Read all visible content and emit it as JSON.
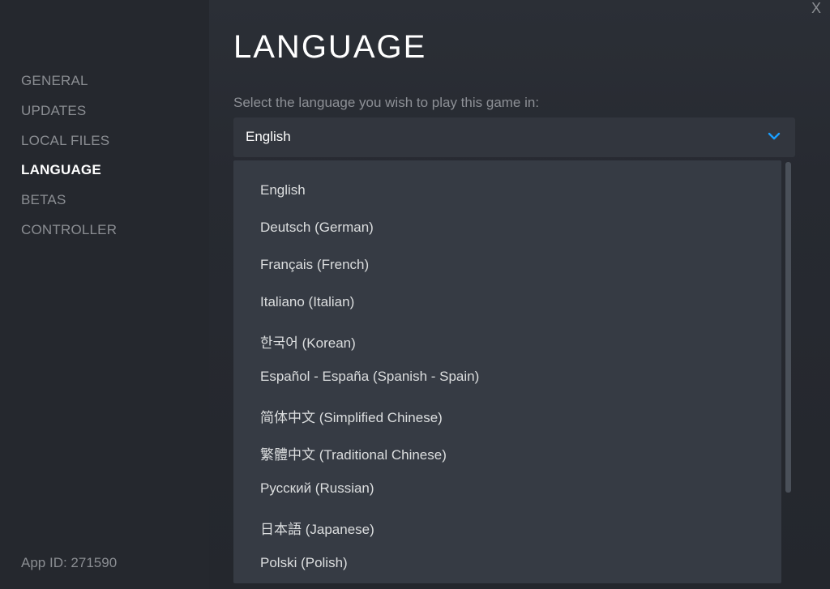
{
  "sidebar": {
    "items": [
      {
        "label": "GENERAL",
        "active": false
      },
      {
        "label": "UPDATES",
        "active": false
      },
      {
        "label": "LOCAL FILES",
        "active": false
      },
      {
        "label": "LANGUAGE",
        "active": true
      },
      {
        "label": "BETAS",
        "active": false
      },
      {
        "label": "CONTROLLER",
        "active": false
      }
    ],
    "app_id": "App ID: 271590"
  },
  "main": {
    "close_label": "X",
    "title": "LANGUAGE",
    "select_label": "Select the language you wish to play this game in:",
    "select_value": "English",
    "options": [
      "English",
      "Deutsch (German)",
      "Français (French)",
      "Italiano (Italian)",
      "한국어 (Korean)",
      "Español - España (Spanish - Spain)",
      "简体中文 (Simplified Chinese)",
      "繁體中文 (Traditional Chinese)",
      "Русский (Russian)",
      "日本語 (Japanese)",
      "Polski (Polish)"
    ]
  },
  "colors": {
    "accent": "#1a9fff",
    "sidebar_bg": "#25282e",
    "dropdown_bg": "#363b44"
  }
}
